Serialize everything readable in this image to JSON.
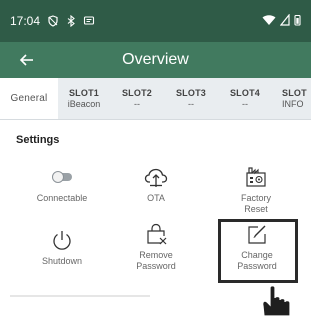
{
  "status_bar": {
    "time": "17:04",
    "icons": [
      "vpn-shield-icon",
      "bluetooth-icon",
      "message-icon"
    ],
    "right_icons": [
      "wifi-icon",
      "signal-icon",
      "battery-icon"
    ]
  },
  "app_bar": {
    "back_icon": "back-arrow-icon",
    "title": "Overview"
  },
  "tabs": [
    {
      "name": "General",
      "sub": ""
    },
    {
      "name": "SLOT1",
      "sub": "iBeacon"
    },
    {
      "name": "SLOT2",
      "sub": "--"
    },
    {
      "name": "SLOT3",
      "sub": "--"
    },
    {
      "name": "SLOT4",
      "sub": "--"
    },
    {
      "name": "SLOT",
      "sub": "INFO"
    }
  ],
  "settings": {
    "title": "Settings",
    "tiles": [
      {
        "label": "Connectable",
        "icon": "toggle-icon"
      },
      {
        "label": "OTA",
        "icon": "cloud-upload-icon"
      },
      {
        "label": "Factory\nReset",
        "icon": "factory-icon"
      },
      {
        "label": "Shutdown",
        "icon": "power-icon"
      },
      {
        "label": "Remove\nPassword",
        "icon": "remove-password-icon"
      },
      {
        "label": "Change\nPassword",
        "icon": "edit-icon"
      }
    ]
  },
  "colors": {
    "status_bar": "#2f5b47",
    "app_bar": "#417a5f",
    "tab_bar": "#e9edf0"
  }
}
